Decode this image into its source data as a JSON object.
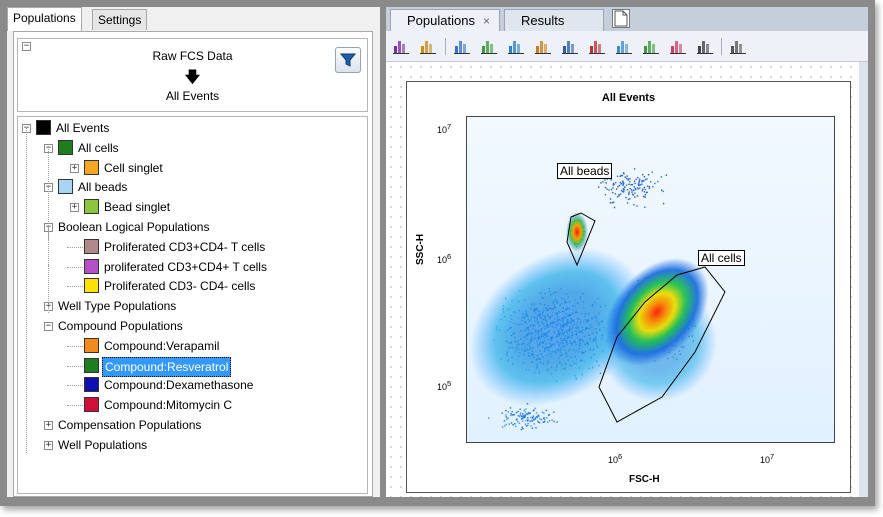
{
  "left_tabs": [
    "Populations",
    "Settings"
  ],
  "hierarchy": {
    "top": "Raw FCS Data",
    "bottom": "All Events",
    "collapse": "−"
  },
  "tree": [
    {
      "label": "All Events",
      "color": "#000000",
      "level": 0,
      "expander": "−"
    },
    {
      "label": "All cells",
      "color": "#1e7d1e",
      "level": 1,
      "expander": "−"
    },
    {
      "label": "Cell singlet",
      "color": "#f5a623",
      "level": 2,
      "expander": "+"
    },
    {
      "label": "All beads",
      "color": "#a8d4f5",
      "level": 1,
      "expander": "−"
    },
    {
      "label": "Bead singlet",
      "color": "#8cc63f",
      "level": 2,
      "expander": "+"
    },
    {
      "label": "Boolean Logical Populations",
      "color": "",
      "level": 1,
      "expander": "−"
    },
    {
      "label": "Proliferated CD3+CD4- T cells",
      "color": "#b08a8a",
      "level": 2,
      "expander": ""
    },
    {
      "label": "proliferated CD3+CD4+ T cells",
      "color": "#b44fc8",
      "level": 2,
      "expander": ""
    },
    {
      "label": "Proliferated CD3- CD4- cells",
      "color": "#ffe000",
      "level": 2,
      "expander": ""
    },
    {
      "label": "Well Type Populations",
      "color": "",
      "level": 1,
      "expander": "+"
    },
    {
      "label": "Compound Populations",
      "color": "",
      "level": 1,
      "expander": "−"
    },
    {
      "label": "Compound:Verapamil",
      "color": "#f28a1e",
      "level": 2,
      "expander": ""
    },
    {
      "label": "Compound:Resveratrol",
      "color": "#1e7d1e",
      "level": 2,
      "expander": "",
      "selected": true
    },
    {
      "label": "Compound:Dexamethasone",
      "color": "#1010b0",
      "level": 2,
      "expander": ""
    },
    {
      "label": "Compound:Mitomycin C",
      "color": "#d0103a",
      "level": 2,
      "expander": ""
    },
    {
      "label": "Compensation Populations",
      "color": "",
      "level": 1,
      "expander": "+"
    },
    {
      "label": "Well Populations",
      "color": "",
      "level": 1,
      "expander": "+"
    }
  ],
  "right_tabs": [
    {
      "label": "Populations",
      "close": "×"
    },
    {
      "label": "Results",
      "close": ""
    }
  ],
  "toolbar_icons": [
    "gate-overlay-icon",
    "add-plot-icon",
    "histogram-icon",
    "histogram-color-icon",
    "scatter-icon",
    "scatter-color-icon",
    "sum-icon",
    "heatmap-icon",
    "scatter-add-icon",
    "density-icon",
    "density-add-icon",
    "table-icon",
    "list-icon"
  ],
  "plot": {
    "title": "All Events",
    "xlabel": "FSC-H",
    "ylabel": "SSC-H",
    "xticks": [
      {
        "label": "10",
        "exp": "6"
      },
      {
        "label": "10",
        "exp": "7"
      }
    ],
    "yticks": [
      {
        "label": "10",
        "exp": "7"
      },
      {
        "label": "10",
        "exp": "6"
      },
      {
        "label": "10",
        "exp": "5"
      }
    ],
    "gates": [
      "All beads",
      "All cells"
    ]
  },
  "colors": {
    "selection": "#3399ff",
    "frame": "#8a8a8a"
  }
}
